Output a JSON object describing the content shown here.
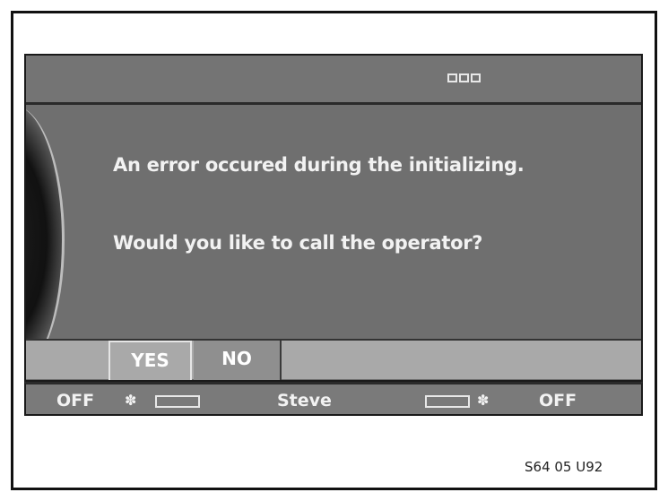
{
  "topbar": {
    "icon": "three-boxes-icon"
  },
  "dialog": {
    "line1": "An error occured during the initializing.",
    "line2": "Would you like to call the operator?"
  },
  "buttons": {
    "yes_label": "YES",
    "no_label": "NO",
    "selected": "YES"
  },
  "status": {
    "left_off": "OFF",
    "left_fan_icon": "fan-icon",
    "left_level_icon": "temperature-bar-icon",
    "user": "Steve",
    "right_level_icon": "temperature-bar-icon",
    "right_fan_icon": "fan-icon",
    "right_off": "OFF"
  },
  "figure_code": "S64 05 U92",
  "colors": {
    "screen": "#6f6f6f",
    "button_bar": "#a9a9a9",
    "text": "#f2f2f2"
  }
}
